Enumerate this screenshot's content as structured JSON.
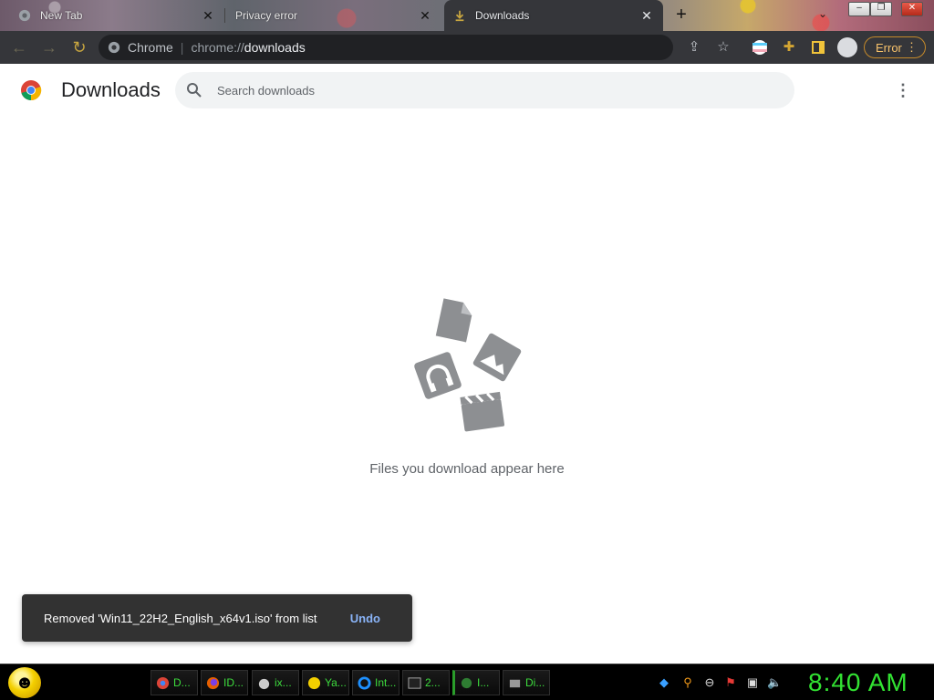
{
  "tabs": [
    {
      "title": "New Tab",
      "icon": "chrome-favicon",
      "active": false
    },
    {
      "title": "Privacy error",
      "icon": "none",
      "active": false
    },
    {
      "title": "Downloads",
      "icon": "downloads-favicon",
      "active": true
    }
  ],
  "toolbar": {
    "origin": "Chrome",
    "url_scheme": "chrome://",
    "url_path": "downloads",
    "error_label": "Error"
  },
  "page": {
    "title": "Downloads",
    "search_placeholder": "Search downloads",
    "empty_message": "Files you download appear here"
  },
  "toast": {
    "message": "Removed 'Win11_22H2_English_x64v1.iso' from list",
    "action": "Undo"
  },
  "taskbar": {
    "items": [
      "D...",
      "ID...",
      "ix...",
      "Ya...",
      "Int...",
      "2...",
      "I...",
      "Di..."
    ],
    "clock": "8:40 AM"
  },
  "colors": {
    "toolbar_bg": "#35363a",
    "accent_blue": "#8ab4f8",
    "clock_green": "#32e232",
    "error_orange": "#f7c26b"
  }
}
